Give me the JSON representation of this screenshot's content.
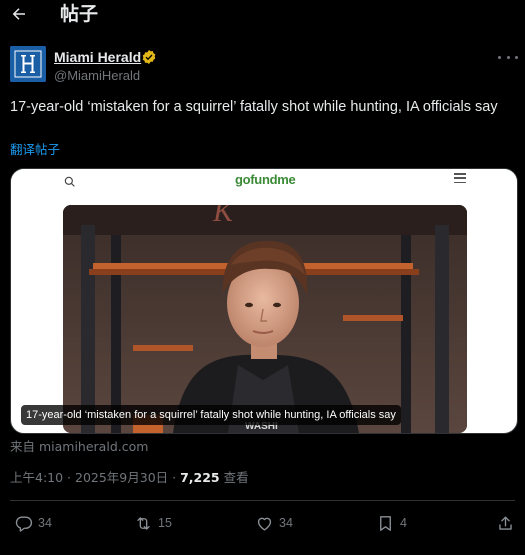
{
  "header": {
    "back_icon": "arrow-left-icon",
    "title": "帖子"
  },
  "author": {
    "name": "Miami Herald",
    "handle": "@MiamiHerald",
    "verified": true,
    "avatar_color": "#1a5ea6"
  },
  "post": {
    "text": "17-year-old ‘mistaken for a squirrel’ fatally shot while hunting, IA officials say",
    "translate_label": "翻译帖子"
  },
  "card": {
    "site_logo": "gofundme",
    "caption": "17-year-old ‘mistaken for a squirrel’ fatally shot while hunting, IA officials say",
    "source": "来自 miamiherald.com"
  },
  "meta": {
    "time": "上午4:10",
    "separator": " · ",
    "date": "2025年9月30日",
    "views_separator": " · ",
    "views_count": "7,225",
    "views_label": "查看"
  },
  "actions": {
    "reply_count": "34",
    "repost_count": "15",
    "like_count": "34",
    "bookmark_count": "4"
  },
  "colors": {
    "accent": "#1d9bf0",
    "verified": "#e2b719",
    "muted": "#71767b",
    "background": "#000000"
  }
}
